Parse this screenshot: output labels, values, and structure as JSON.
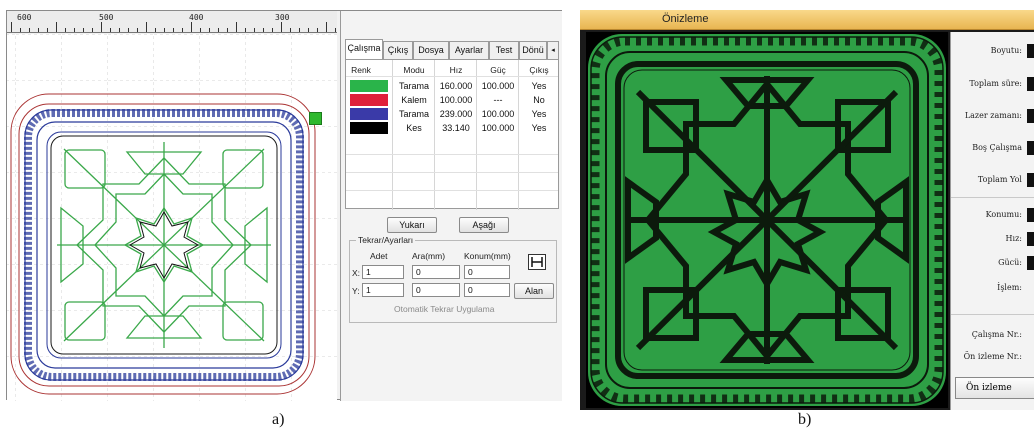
{
  "panel_a": {
    "ruler": {
      "labels": [
        "600",
        "500",
        "400",
        "300"
      ]
    },
    "tabs": [
      {
        "label": "Çalışma",
        "active": true
      },
      {
        "label": "Çıkış"
      },
      {
        "label": "Dosya"
      },
      {
        "label": "Ayarlar"
      },
      {
        "label": "Test"
      },
      {
        "label": "Dönü"
      }
    ],
    "tab_scroll_icon": "arrow-left-icon",
    "table": {
      "headers": [
        "Renk",
        "Modu",
        "Hız",
        "Güç",
        "Çıkış"
      ],
      "rows": [
        {
          "color": "#2ab44a",
          "mode": "Tarama",
          "speed": "160.000",
          "power": "100.000",
          "output": "Yes"
        },
        {
          "color": "#e0203a",
          "mode": "Kalem",
          "speed": "100.000",
          "power": "---",
          "output": "No"
        },
        {
          "color": "#3a3aa8",
          "mode": "Tarama",
          "speed": "239.000",
          "power": "100.000",
          "output": "Yes"
        },
        {
          "color": "#000000",
          "mode": "Kes",
          "speed": "33.140",
          "power": "100.000",
          "output": "Yes"
        }
      ]
    },
    "buttons": {
      "up": "Yukarı",
      "down": "Aşağı",
      "area": "Alan"
    },
    "repeat": {
      "title": "Tekrar/Ayarları",
      "col_count": "Adet",
      "col_gap": "Ara(mm)",
      "col_pos": "Konum(mm)",
      "x_label": "X:",
      "y_label": "Y:",
      "x_count": "1",
      "y_count": "1",
      "x_gap": "0",
      "y_gap": "0",
      "x_pos": "0",
      "y_pos": "0",
      "auto_apply": "Otomatik Tekrar Uygulama"
    },
    "colors": {
      "blue_ornament": "#2a3a9a",
      "green_pattern": "#3aa84a",
      "red_outline": "#a33"
    }
  },
  "panel_b": {
    "title": "Önizleme",
    "labels": {
      "size": "Boyutu:",
      "total_time": "Toplam süre:",
      "laser_time": "Lazer zamanı:",
      "idle": "Boş Çalışma",
      "total_path": "Toplam Yol",
      "position": "Konumu:",
      "speed": "Hız:",
      "power": "Gücü:",
      "process": "İşlem:",
      "run_no": "Çalışma Nr.:",
      "preview_no": "Ön izleme Nr.:"
    },
    "button": "Ön izleme",
    "colors": {
      "fill": "#2e9f45",
      "lines": "#0c1a0c"
    }
  },
  "captions": {
    "a": "a)",
    "b": "b)"
  }
}
